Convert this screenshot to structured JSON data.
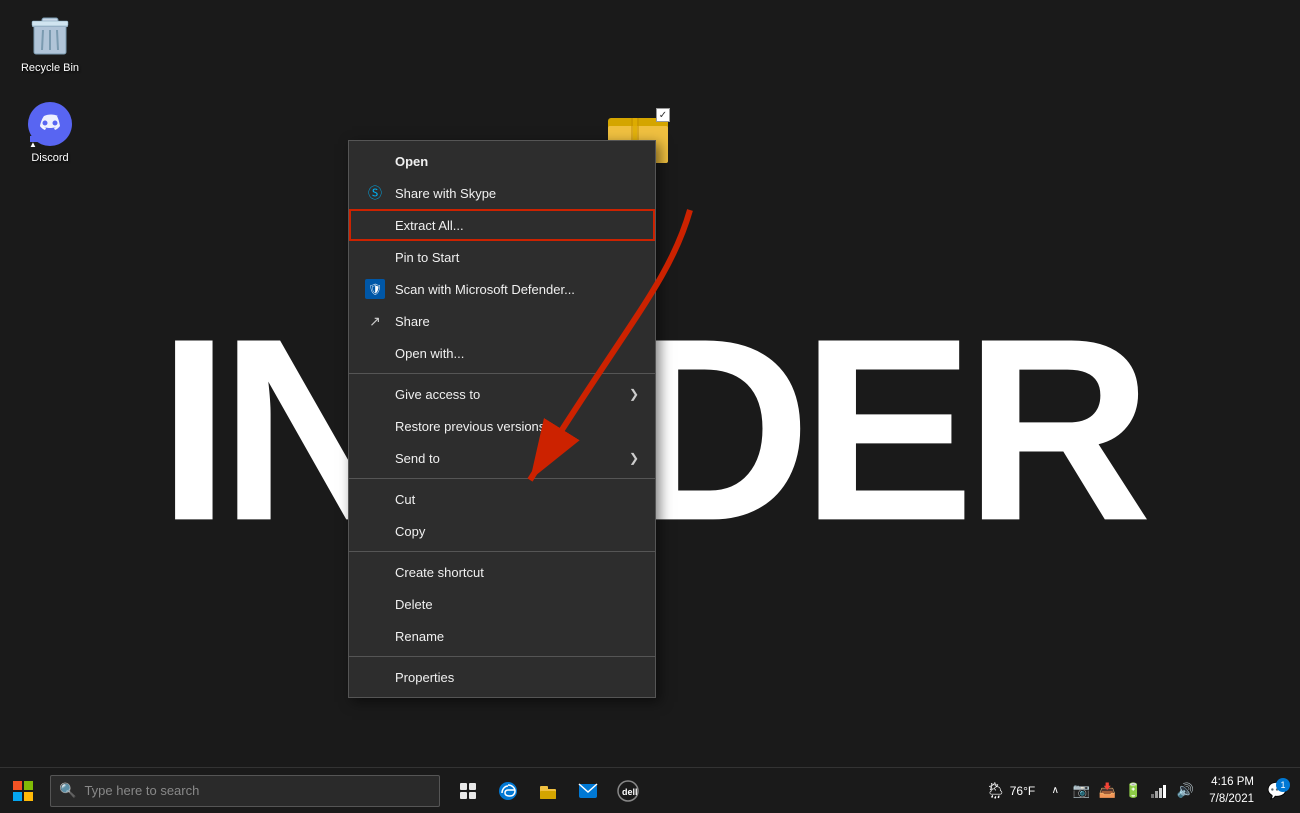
{
  "desktop": {
    "icons": {
      "recycle_bin": {
        "label": "Recycle Bin"
      },
      "discord": {
        "label": "Discord"
      }
    },
    "bg_text": "INSIDER"
  },
  "context_menu": {
    "items": [
      {
        "id": "open",
        "label": "Open",
        "icon": "",
        "has_arrow": false,
        "bold": true,
        "highlighted": false,
        "separator_after": false
      },
      {
        "id": "share-skype",
        "label": "Share with Skype",
        "icon": "skype",
        "has_arrow": false,
        "bold": false,
        "highlighted": false,
        "separator_after": false
      },
      {
        "id": "extract-all",
        "label": "Extract All...",
        "icon": "",
        "has_arrow": false,
        "bold": false,
        "highlighted": true,
        "separator_after": false
      },
      {
        "id": "pin-to-start",
        "label": "Pin to Start",
        "icon": "",
        "has_arrow": false,
        "bold": false,
        "highlighted": false,
        "separator_after": false
      },
      {
        "id": "scan-defender",
        "label": "Scan with Microsoft Defender...",
        "icon": "defender",
        "has_arrow": false,
        "bold": false,
        "highlighted": false,
        "separator_after": false
      },
      {
        "id": "share",
        "label": "Share",
        "icon": "share",
        "has_arrow": false,
        "bold": false,
        "highlighted": false,
        "separator_after": false
      },
      {
        "id": "open-with",
        "label": "Open with...",
        "icon": "",
        "has_arrow": false,
        "bold": false,
        "highlighted": false,
        "separator_after": true
      },
      {
        "id": "give-access",
        "label": "Give access to",
        "icon": "",
        "has_arrow": true,
        "bold": false,
        "highlighted": false,
        "separator_after": false
      },
      {
        "id": "restore-prev",
        "label": "Restore previous versions",
        "icon": "",
        "has_arrow": false,
        "bold": false,
        "highlighted": false,
        "separator_after": false
      },
      {
        "id": "send-to",
        "label": "Send to",
        "icon": "",
        "has_arrow": true,
        "bold": false,
        "highlighted": false,
        "separator_after": true
      },
      {
        "id": "cut",
        "label": "Cut",
        "icon": "",
        "has_arrow": false,
        "bold": false,
        "highlighted": false,
        "separator_after": false
      },
      {
        "id": "copy",
        "label": "Copy",
        "icon": "",
        "has_arrow": false,
        "bold": false,
        "highlighted": false,
        "separator_after": true
      },
      {
        "id": "create-shortcut",
        "label": "Create shortcut",
        "icon": "",
        "has_arrow": false,
        "bold": false,
        "highlighted": false,
        "separator_after": false
      },
      {
        "id": "delete",
        "label": "Delete",
        "icon": "",
        "has_arrow": false,
        "bold": false,
        "highlighted": false,
        "separator_after": false
      },
      {
        "id": "rename",
        "label": "Rename",
        "icon": "",
        "has_arrow": false,
        "bold": false,
        "highlighted": false,
        "separator_after": true
      },
      {
        "id": "properties",
        "label": "Properties",
        "icon": "",
        "has_arrow": false,
        "bold": false,
        "highlighted": false,
        "separator_after": false
      }
    ]
  },
  "taskbar": {
    "search_placeholder": "Type here to search",
    "time": "4:16 PM",
    "date": "7/8/2021",
    "weather": "76°F",
    "notification_count": "1"
  }
}
